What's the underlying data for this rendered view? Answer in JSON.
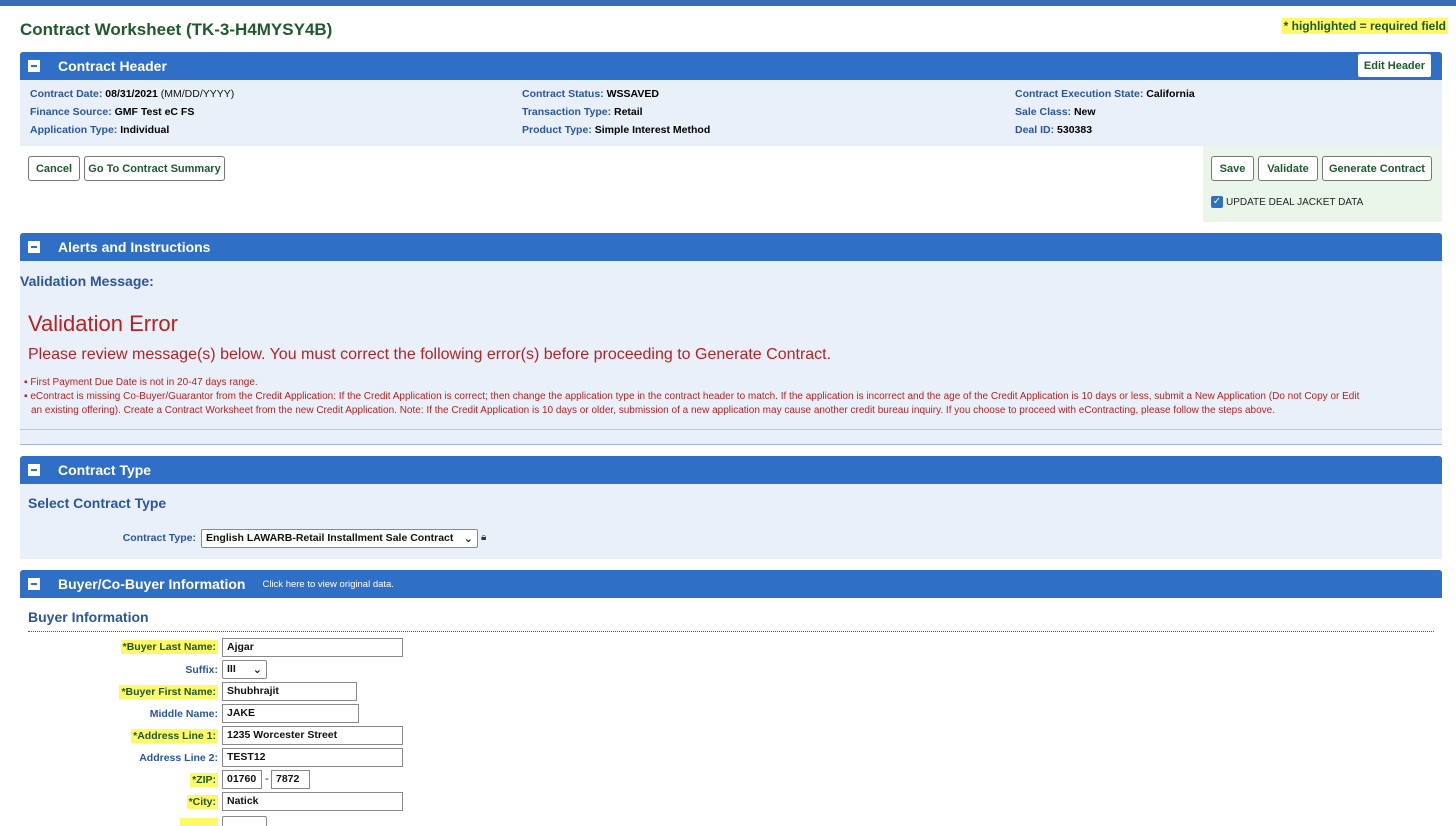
{
  "page": {
    "title": "Contract Worksheet (TK-3-H4MYSY4B)",
    "required_note": "* highlighted = required field"
  },
  "contract_header": {
    "section_title": "Contract Header",
    "edit_button": "Edit Header",
    "fields": {
      "contract_date_label": "Contract Date:",
      "contract_date_value": "08/31/2021",
      "contract_date_hint": "(MM/DD/YYYY)",
      "finance_source_label": "Finance Source:",
      "finance_source_value": "GMF Test eC FS",
      "application_type_label": "Application Type:",
      "application_type_value": "Individual",
      "contract_status_label": "Contract Status:",
      "contract_status_value": "WSSAVED",
      "transaction_type_label": "Transaction Type:",
      "transaction_type_value": "Retail",
      "product_type_label": "Product Type:",
      "product_type_value": "Simple Interest Method",
      "execution_state_label": "Contract Execution State:",
      "execution_state_value": "California",
      "sale_class_label": "Sale Class:",
      "sale_class_value": "New",
      "deal_id_label": "Deal ID:",
      "deal_id_value": "530383"
    }
  },
  "actions": {
    "cancel": "Cancel",
    "go_summary": "Go To Contract Summary",
    "save": "Save",
    "validate": "Validate",
    "generate": "Generate Contract",
    "update_jacket_label": "UPDATE DEAL JACKET DATA"
  },
  "alerts": {
    "section_title": "Alerts and Instructions",
    "validation_label": "Validation Message:",
    "error_title": "Validation Error",
    "error_subtitle": "Please review message(s) below. You must correct the following error(s) before proceeding to Generate Contract.",
    "messages": [
      "First Payment Due Date is not in 20-47 days range.",
      "eContract is missing Co-Buyer/Guarantor from the Credit Application: If the Credit Application is correct; then change the application type in the contract header to match. If the application is incorrect and the age of the Credit Application is 10 days or less, submit a New Application (Do not Copy or Edit",
      "an existing offering). Create a Contract Worksheet from the new Credit Application. Note: If the Credit Application is 10 days or older, submission of a new application may cause another credit bureau inquiry. If you choose to proceed with eContracting, please follow the steps above."
    ]
  },
  "contract_type": {
    "section_title": "Contract Type",
    "sub_title": "Select Contract Type",
    "label": "Contract Type:",
    "selected": "English LAWARB-Retail Installment Sale Contract"
  },
  "buyer": {
    "section_title": "Buyer/Co-Buyer Information",
    "original_link": "Click here to view original data.",
    "sub_title": "Buyer Information",
    "last_name_label": "*Buyer Last Name:",
    "last_name": "Ajgar",
    "suffix_label": "Suffix:",
    "suffix": "III",
    "first_name_label": "*Buyer First Name:",
    "first_name": "Shubhrajit",
    "middle_name_label": "Middle Name:",
    "middle_name": "JAKE",
    "address1_label": "*Address Line 1:",
    "address1": "1235 Worcester Street",
    "address2_label": "Address Line 2:",
    "address2": "TEST12",
    "zip_label": "*ZIP:",
    "zip": "01760",
    "zip_sep": "-",
    "zip4": "7872",
    "city_label": "*City:",
    "city": "Natick"
  }
}
